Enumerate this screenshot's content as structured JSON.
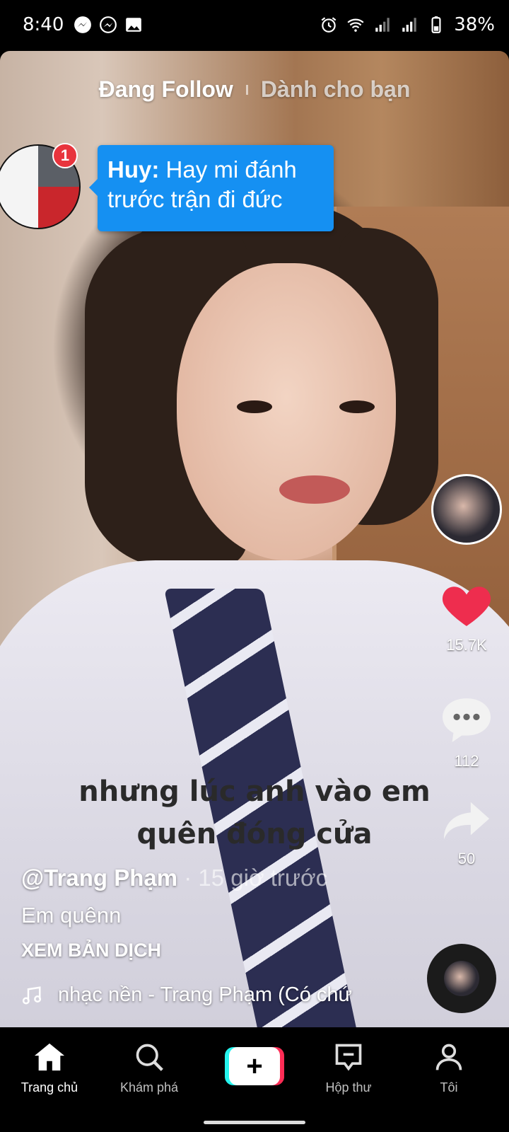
{
  "status_bar": {
    "time": "8:40",
    "battery": "38%",
    "left_icons": [
      "messenger-icon",
      "messenger-icon",
      "gallery-icon"
    ],
    "right_icons": [
      "alarm-icon",
      "wifi-icon",
      "signal-icon",
      "signal-icon",
      "battery-icon"
    ]
  },
  "tabs": {
    "following": "Đang Follow",
    "for_you": "Dành cho bạn"
  },
  "chat_bubble": {
    "badge_count": "1",
    "sender": "Huy:",
    "message": "Hay mi đánh trước trận đi đức"
  },
  "video": {
    "overlay_line1": "nhưng lúc anh vào em",
    "overlay_line2": "quên đóng cửa"
  },
  "actions": {
    "likes": "15.7K",
    "comments": "112",
    "shares": "50"
  },
  "post": {
    "author": "@Trang Phạm",
    "time_ago": "· 15 giờ trước",
    "description": "Em quênn",
    "translate": "XEM BẢN DỊCH",
    "music": "nhạc nền - Trang Phạm (Có chứ"
  },
  "nav": {
    "home": "Trang chủ",
    "discover": "Khám phá",
    "inbox": "Hộp thư",
    "profile": "Tôi"
  },
  "colors": {
    "accent_red": "#fe2c55",
    "accent_cyan": "#25f4ee",
    "like_red": "#ee2d4e",
    "bubble_blue": "#1590f2"
  }
}
